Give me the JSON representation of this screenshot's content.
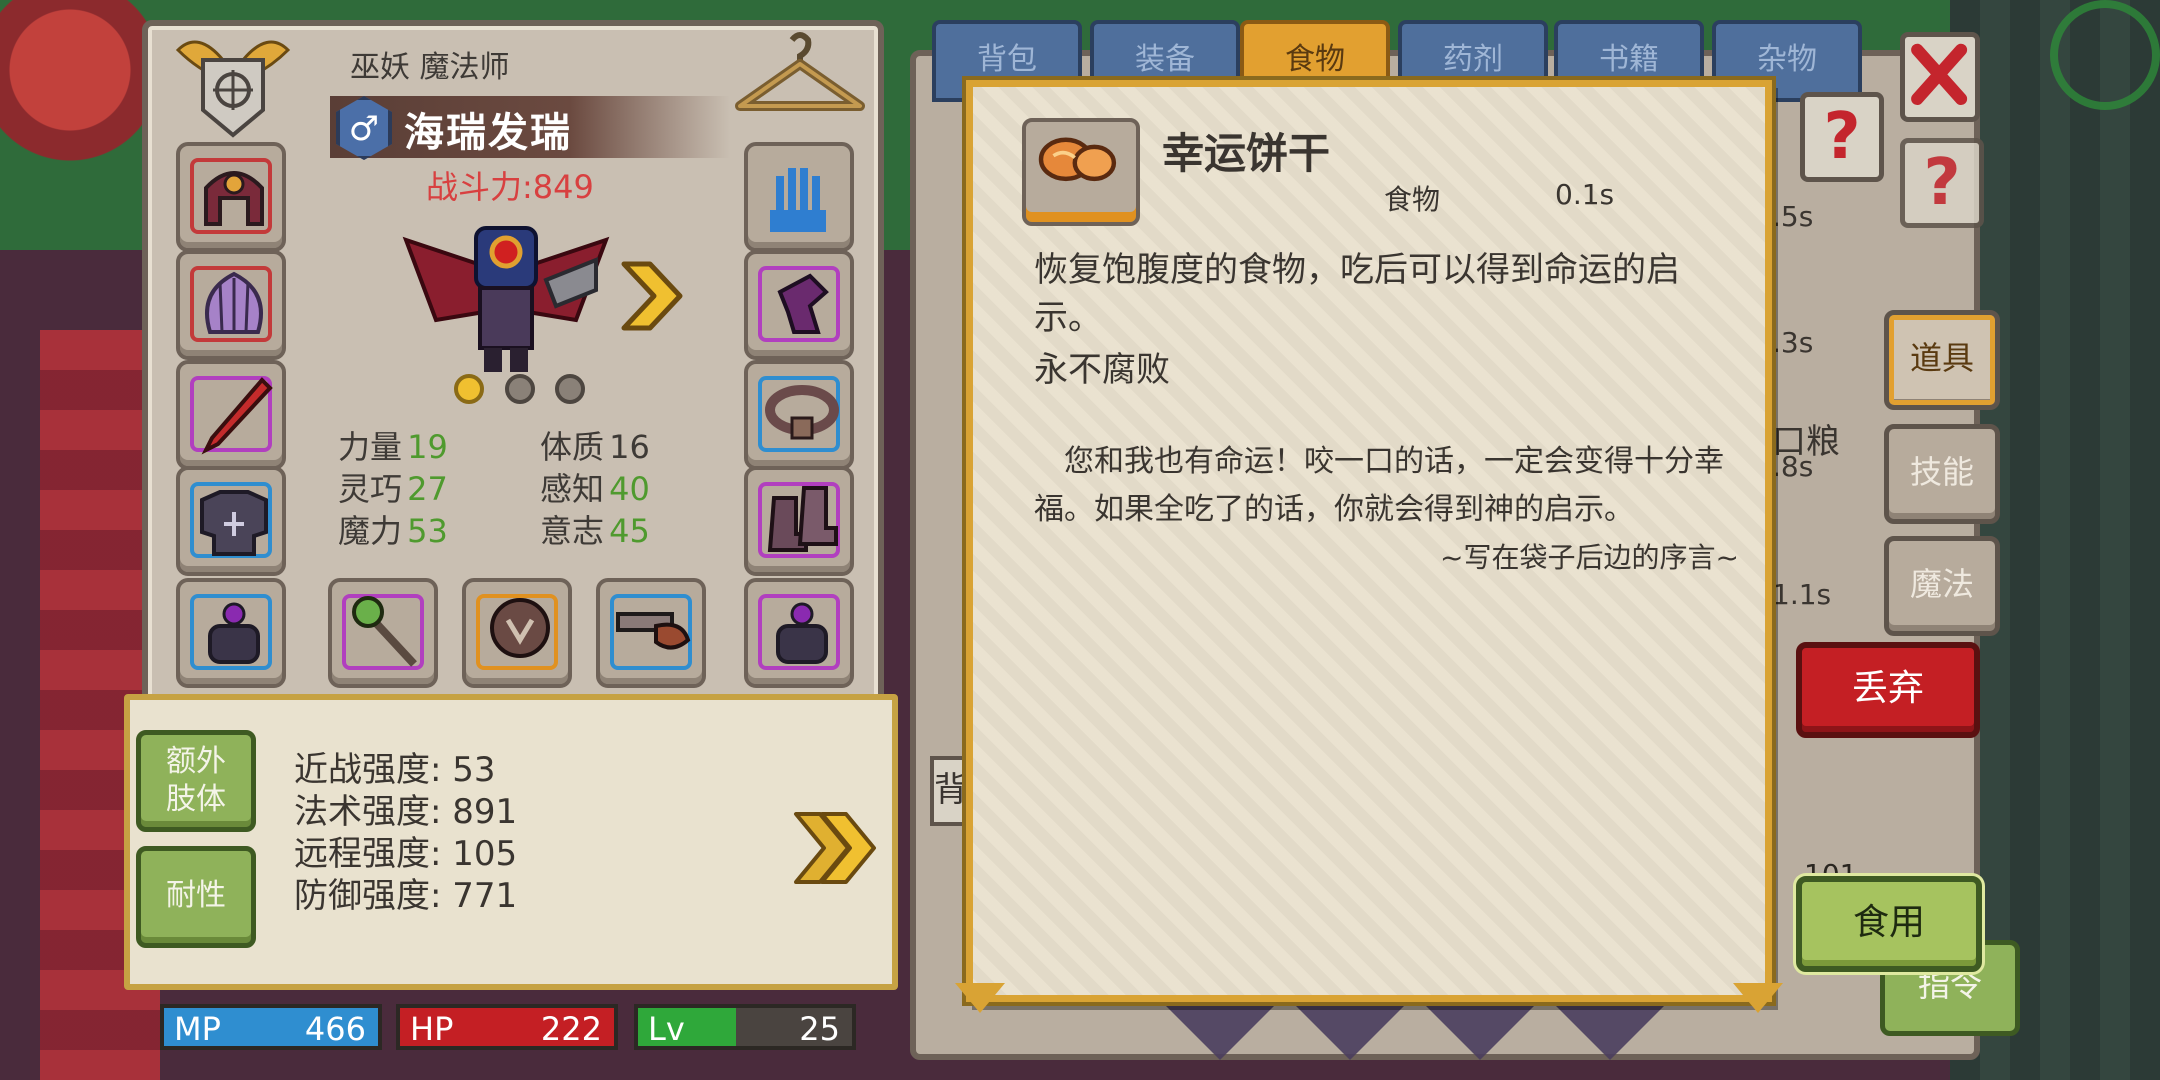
{
  "character": {
    "class": "巫妖 魔法师",
    "gender_symbol": "♂",
    "name": "海瑞发瑞",
    "combat_power": "战斗力:849",
    "stats": [
      {
        "name": "力量",
        "value": "19"
      },
      {
        "name": "体质",
        "value": "16"
      },
      {
        "name": "灵巧",
        "value": "27"
      },
      {
        "name": "感知",
        "value": "40"
      },
      {
        "name": "魔力",
        "value": "53"
      },
      {
        "name": "意志",
        "value": "45"
      }
    ],
    "page_dots": {
      "count": 3,
      "active_index": 0
    }
  },
  "strength_panel": {
    "extra_limb_label": "额外\n肢体",
    "resistance_label": "耐性",
    "lines": [
      "近战强度: 53",
      "法术强度: 891",
      "远程强度: 105",
      "防御强度: 771"
    ]
  },
  "bars": {
    "mp": {
      "label": "MP",
      "value": "466"
    },
    "hp": {
      "label": "HP",
      "value": "222"
    },
    "lv": {
      "label": "Lv",
      "value": "25"
    }
  },
  "inventory": {
    "tabs": [
      "背包",
      "装备",
      "食物",
      "药剂",
      "书籍",
      "杂物"
    ],
    "active_tab": "食物",
    "peek": [
      ".5s",
      ".3s",
      "口粮",
      ".8s",
      "1.1s",
      "背",
      "101"
    ]
  },
  "side_buttons": [
    "道具",
    "技能",
    "魔法"
  ],
  "actions": {
    "discard": "丢弃",
    "eat": "食用",
    "command": "指令",
    "help": "?"
  },
  "item": {
    "name": "幸运饼干",
    "category": "食物",
    "weight": "0.1s",
    "description": "恢复饱腹度的食物，吃后可以得到命运的启示。",
    "property": "永不腐败",
    "flavor_text": "您和我也有命运！咬一口的话，一定会变得十分幸福。如果全吃了的话，你就会得到神的启示。",
    "flavor_signature": "~写在袋子后边的序言~"
  },
  "colors": {
    "mp": "#2f8ed0",
    "hp": "#c41f24",
    "lv": "#2fa83a",
    "combat_power": "#d84040",
    "stat_value": "#4f9a2e",
    "card_border": "#d9a334"
  }
}
